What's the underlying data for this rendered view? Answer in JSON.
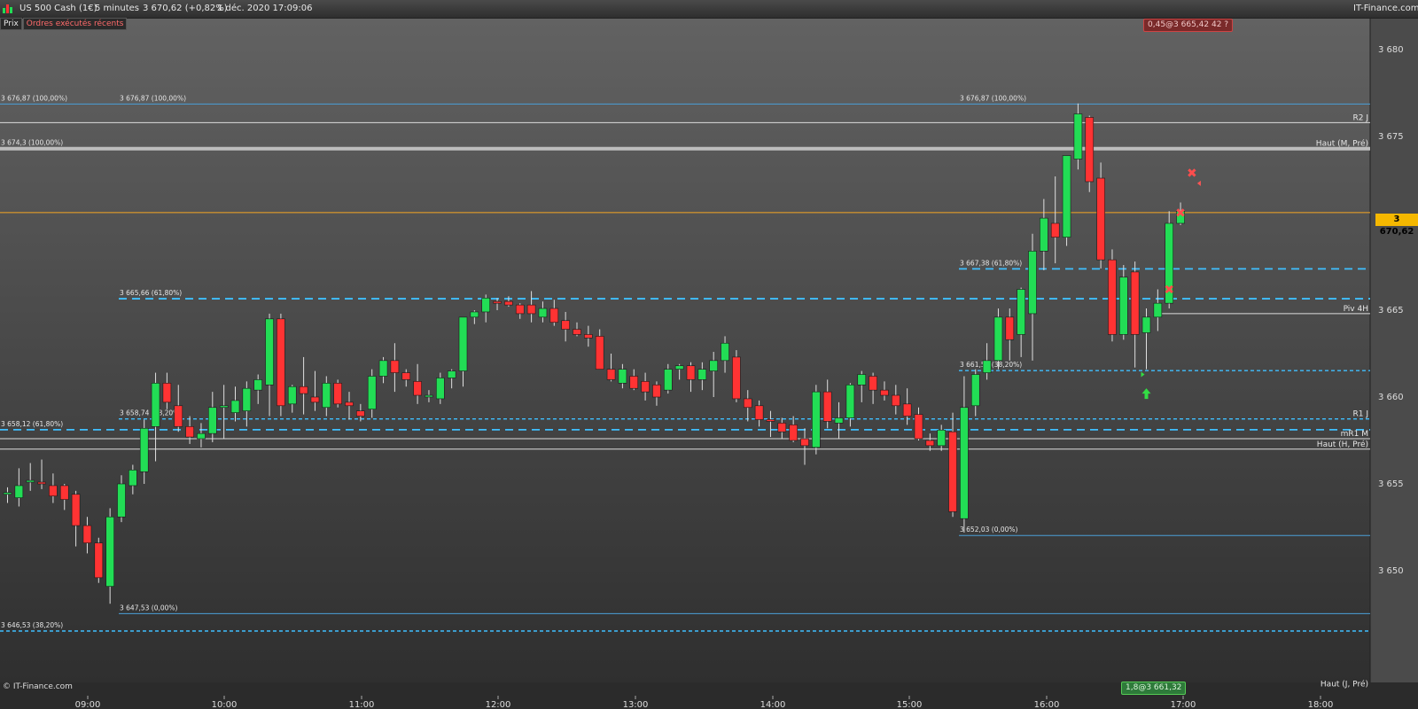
{
  "header": {
    "instrument": "US 500 Cash (1€)",
    "timeframe": "5 minutes",
    "quote": "3 670,62 (+0,82%)",
    "datetime": "1 déc. 2020 17:09:06",
    "brand": "IT-Finance.com"
  },
  "subheader": {
    "prix_label": "Prix",
    "recent_orders_label": "Ordres exécutés récents"
  },
  "badges": {
    "top_order": "0,45@3 665,42 42 ?",
    "bottom_order": "1,8@3 661,32"
  },
  "last_price": "3 670,62",
  "watermark": "© IT-Finance.com",
  "colors": {
    "up": "#22dd55",
    "down": "#ff3333",
    "level_line": "#4a9fd8",
    "dashed_level": "#3fc0ff",
    "last_price": "#f5a623",
    "white_line": "#dddddd"
  },
  "chart_data": {
    "type": "candlestick",
    "ylim": [
      3645,
      3682
    ],
    "yticks": [
      {
        "value": 3680,
        "label": "3 680"
      },
      {
        "value": 3675,
        "label": "3 675"
      },
      {
        "value": 3670,
        "label": "3 670"
      },
      {
        "value": 3665,
        "label": "3 665"
      },
      {
        "value": 3660,
        "label": "3 660"
      },
      {
        "value": 3655,
        "label": "3 655"
      },
      {
        "value": 3650,
        "label": "3 650"
      }
    ],
    "xticks": [
      "09:00",
      "10:00",
      "11:00",
      "12:00",
      "13:00",
      "14:00",
      "15:00",
      "16:00",
      "17:00",
      "18:00"
    ],
    "candles": [
      {
        "o": 3654.4,
        "h": 3654.8,
        "l": 3653.9,
        "c": 3654.5
      },
      {
        "o": 3654.2,
        "h": 3655.9,
        "l": 3653.7,
        "c": 3654.9
      },
      {
        "o": 3655.1,
        "h": 3656.2,
        "l": 3654.6,
        "c": 3655.2
      },
      {
        "o": 3655.1,
        "h": 3656.4,
        "l": 3654.7,
        "c": 3655.0
      },
      {
        "o": 3654.9,
        "h": 3655.6,
        "l": 3653.9,
        "c": 3654.3
      },
      {
        "o": 3654.9,
        "h": 3655.0,
        "l": 3653.5,
        "c": 3654.1
      },
      {
        "o": 3654.4,
        "h": 3654.6,
        "l": 3651.4,
        "c": 3652.6
      },
      {
        "o": 3652.6,
        "h": 3653.1,
        "l": 3651.0,
        "c": 3651.6
      },
      {
        "o": 3651.6,
        "h": 3651.9,
        "l": 3649.3,
        "c": 3649.6
      },
      {
        "o": 3649.1,
        "h": 3653.6,
        "l": 3648.1,
        "c": 3653.1
      },
      {
        "o": 3653.1,
        "h": 3655.5,
        "l": 3652.8,
        "c": 3655.0
      },
      {
        "o": 3654.9,
        "h": 3656.1,
        "l": 3654.4,
        "c": 3655.8
      },
      {
        "o": 3655.7,
        "h": 3658.7,
        "l": 3655.0,
        "c": 3658.2
      },
      {
        "o": 3658.3,
        "h": 3661.4,
        "l": 3656.3,
        "c": 3660.8
      },
      {
        "o": 3660.8,
        "h": 3661.4,
        "l": 3659.3,
        "c": 3659.7
      },
      {
        "o": 3659.5,
        "h": 3660.7,
        "l": 3658.0,
        "c": 3658.3
      },
      {
        "o": 3658.3,
        "h": 3658.9,
        "l": 3657.3,
        "c": 3657.7
      },
      {
        "o": 3657.6,
        "h": 3658.5,
        "l": 3657.1,
        "c": 3657.9
      },
      {
        "o": 3657.9,
        "h": 3660.3,
        "l": 3657.4,
        "c": 3659.4
      },
      {
        "o": 3659.4,
        "h": 3660.7,
        "l": 3657.6,
        "c": 3659.5
      },
      {
        "o": 3659.1,
        "h": 3660.6,
        "l": 3658.6,
        "c": 3659.8
      },
      {
        "o": 3659.2,
        "h": 3660.9,
        "l": 3658.3,
        "c": 3660.5
      },
      {
        "o": 3660.4,
        "h": 3661.3,
        "l": 3659.6,
        "c": 3661.0
      },
      {
        "o": 3660.7,
        "h": 3664.8,
        "l": 3658.9,
        "c": 3664.5
      },
      {
        "o": 3664.5,
        "h": 3664.8,
        "l": 3658.9,
        "c": 3659.5
      },
      {
        "o": 3659.6,
        "h": 3660.7,
        "l": 3659.1,
        "c": 3660.6
      },
      {
        "o": 3660.6,
        "h": 3662.3,
        "l": 3659.0,
        "c": 3660.2
      },
      {
        "o": 3660.0,
        "h": 3661.5,
        "l": 3659.2,
        "c": 3659.7
      },
      {
        "o": 3659.4,
        "h": 3661.2,
        "l": 3658.9,
        "c": 3660.8
      },
      {
        "o": 3660.8,
        "h": 3661.0,
        "l": 3659.4,
        "c": 3659.6
      },
      {
        "o": 3659.7,
        "h": 3660.3,
        "l": 3658.7,
        "c": 3659.5
      },
      {
        "o": 3659.2,
        "h": 3659.6,
        "l": 3658.6,
        "c": 3658.9
      },
      {
        "o": 3659.3,
        "h": 3661.6,
        "l": 3658.8,
        "c": 3661.2
      },
      {
        "o": 3661.2,
        "h": 3662.3,
        "l": 3660.8,
        "c": 3662.1
      },
      {
        "o": 3662.1,
        "h": 3663.1,
        "l": 3660.3,
        "c": 3661.4
      },
      {
        "o": 3661.4,
        "h": 3661.6,
        "l": 3660.6,
        "c": 3661.0
      },
      {
        "o": 3660.9,
        "h": 3661.9,
        "l": 3659.6,
        "c": 3660.1
      },
      {
        "o": 3660.0,
        "h": 3660.4,
        "l": 3659.7,
        "c": 3660.1
      },
      {
        "o": 3659.9,
        "h": 3661.4,
        "l": 3659.6,
        "c": 3661.1
      },
      {
        "o": 3661.1,
        "h": 3661.6,
        "l": 3660.5,
        "c": 3661.5
      },
      {
        "o": 3661.5,
        "h": 3664.6,
        "l": 3660.6,
        "c": 3664.6
      },
      {
        "o": 3664.6,
        "h": 3665.0,
        "l": 3664.2,
        "c": 3664.9
      },
      {
        "o": 3664.9,
        "h": 3665.9,
        "l": 3664.3,
        "c": 3665.7
      },
      {
        "o": 3665.5,
        "h": 3665.7,
        "l": 3665.0,
        "c": 3665.4
      },
      {
        "o": 3665.5,
        "h": 3665.8,
        "l": 3665.2,
        "c": 3665.3
      },
      {
        "o": 3665.3,
        "h": 3665.4,
        "l": 3664.5,
        "c": 3664.8
      },
      {
        "o": 3665.3,
        "h": 3666.1,
        "l": 3664.3,
        "c": 3664.8
      },
      {
        "o": 3664.6,
        "h": 3665.5,
        "l": 3664.3,
        "c": 3665.1
      },
      {
        "o": 3665.1,
        "h": 3665.6,
        "l": 3664.1,
        "c": 3664.3
      },
      {
        "o": 3664.4,
        "h": 3664.9,
        "l": 3663.2,
        "c": 3663.9
      },
      {
        "o": 3663.9,
        "h": 3664.3,
        "l": 3663.5,
        "c": 3663.6
      },
      {
        "o": 3663.6,
        "h": 3664.1,
        "l": 3662.9,
        "c": 3663.4
      },
      {
        "o": 3663.5,
        "h": 3663.9,
        "l": 3661.7,
        "c": 3661.6
      },
      {
        "o": 3661.6,
        "h": 3662.5,
        "l": 3660.9,
        "c": 3661.0
      },
      {
        "o": 3660.8,
        "h": 3661.9,
        "l": 3660.5,
        "c": 3661.6
      },
      {
        "o": 3661.2,
        "h": 3661.6,
        "l": 3660.4,
        "c": 3660.5
      },
      {
        "o": 3660.9,
        "h": 3661.4,
        "l": 3659.8,
        "c": 3660.3
      },
      {
        "o": 3660.7,
        "h": 3660.9,
        "l": 3659.5,
        "c": 3660.0
      },
      {
        "o": 3660.4,
        "h": 3661.9,
        "l": 3660.2,
        "c": 3661.6
      },
      {
        "o": 3661.6,
        "h": 3661.9,
        "l": 3661.0,
        "c": 3661.8
      },
      {
        "o": 3661.8,
        "h": 3662.0,
        "l": 3660.3,
        "c": 3661.0
      },
      {
        "o": 3661.0,
        "h": 3662.0,
        "l": 3660.4,
        "c": 3661.6
      },
      {
        "o": 3661.5,
        "h": 3662.6,
        "l": 3660.0,
        "c": 3662.1
      },
      {
        "o": 3662.1,
        "h": 3663.5,
        "l": 3661.4,
        "c": 3663.1
      },
      {
        "o": 3662.3,
        "h": 3662.7,
        "l": 3659.7,
        "c": 3659.9
      },
      {
        "o": 3659.9,
        "h": 3660.4,
        "l": 3658.6,
        "c": 3659.4
      },
      {
        "o": 3659.5,
        "h": 3659.8,
        "l": 3658.3,
        "c": 3658.7
      },
      {
        "o": 3658.7,
        "h": 3659.2,
        "l": 3657.7,
        "c": 3658.6
      },
      {
        "o": 3658.5,
        "h": 3658.8,
        "l": 3657.6,
        "c": 3658.0
      },
      {
        "o": 3658.4,
        "h": 3658.9,
        "l": 3657.4,
        "c": 3657.5
      },
      {
        "o": 3657.6,
        "h": 3658.2,
        "l": 3656.1,
        "c": 3657.2
      },
      {
        "o": 3657.1,
        "h": 3660.7,
        "l": 3656.7,
        "c": 3660.3
      },
      {
        "o": 3660.3,
        "h": 3661.0,
        "l": 3658.2,
        "c": 3658.6
      },
      {
        "o": 3658.5,
        "h": 3659.7,
        "l": 3657.6,
        "c": 3658.8
      },
      {
        "o": 3658.8,
        "h": 3660.8,
        "l": 3658.3,
        "c": 3660.7
      },
      {
        "o": 3660.7,
        "h": 3661.5,
        "l": 3659.7,
        "c": 3661.3
      },
      {
        "o": 3661.2,
        "h": 3661.4,
        "l": 3659.6,
        "c": 3660.4
      },
      {
        "o": 3660.4,
        "h": 3660.9,
        "l": 3659.8,
        "c": 3660.1
      },
      {
        "o": 3660.1,
        "h": 3660.7,
        "l": 3659.0,
        "c": 3659.5
      },
      {
        "o": 3659.6,
        "h": 3660.5,
        "l": 3658.4,
        "c": 3658.9
      },
      {
        "o": 3659.0,
        "h": 3659.4,
        "l": 3657.5,
        "c": 3657.6
      },
      {
        "o": 3657.5,
        "h": 3657.9,
        "l": 3656.9,
        "c": 3657.2
      },
      {
        "o": 3657.2,
        "h": 3658.4,
        "l": 3656.9,
        "c": 3658.1
      },
      {
        "o": 3658.0,
        "h": 3659.1,
        "l": 3653.1,
        "c": 3653.4
      },
      {
        "o": 3653.0,
        "h": 3661.2,
        "l": 3652.2,
        "c": 3659.4
      },
      {
        "o": 3659.5,
        "h": 3661.6,
        "l": 3658.9,
        "c": 3661.3
      },
      {
        "o": 3661.4,
        "h": 3663.1,
        "l": 3661.0,
        "c": 3662.1
      },
      {
        "o": 3662.1,
        "h": 3665.1,
        "l": 3661.6,
        "c": 3664.6
      },
      {
        "o": 3664.6,
        "h": 3665.1,
        "l": 3662.1,
        "c": 3663.3
      },
      {
        "o": 3663.6,
        "h": 3666.3,
        "l": 3662.3,
        "c": 3666.2
      },
      {
        "o": 3664.8,
        "h": 3669.4,
        "l": 3662.1,
        "c": 3668.4
      },
      {
        "o": 3668.4,
        "h": 3671.4,
        "l": 3667.3,
        "c": 3670.3
      },
      {
        "o": 3670.0,
        "h": 3672.7,
        "l": 3667.7,
        "c": 3669.2
      },
      {
        "o": 3669.2,
        "h": 3673.6,
        "l": 3668.7,
        "c": 3673.9
      },
      {
        "o": 3673.7,
        "h": 3676.9,
        "l": 3673.1,
        "c": 3676.3
      },
      {
        "o": 3676.1,
        "h": 3676.2,
        "l": 3671.8,
        "c": 3672.4
      },
      {
        "o": 3672.6,
        "h": 3673.5,
        "l": 3667.4,
        "c": 3667.9
      },
      {
        "o": 3667.9,
        "h": 3668.5,
        "l": 3663.2,
        "c": 3663.6
      },
      {
        "o": 3663.6,
        "h": 3667.6,
        "l": 3663.3,
        "c": 3666.9
      },
      {
        "o": 3667.2,
        "h": 3667.8,
        "l": 3661.7,
        "c": 3663.6
      },
      {
        "o": 3663.7,
        "h": 3665.1,
        "l": 3661.6,
        "c": 3664.6
      },
      {
        "o": 3664.6,
        "h": 3666.2,
        "l": 3663.8,
        "c": 3665.4
      },
      {
        "o": 3665.4,
        "h": 3670.7,
        "l": 3665.1,
        "c": 3670.0
      },
      {
        "o": 3670.0,
        "h": 3671.2,
        "l": 3669.9,
        "c": 3670.7
      }
    ],
    "levels": [
      {
        "value": 3676.87,
        "style": "solid",
        "color": "level",
        "from_x": 0,
        "label": "3 676,87 (100,00%)",
        "label_left": "3 676,87 (100,00%)"
      },
      {
        "value": 3676.87,
        "style": "none",
        "from_x": 134,
        "label": "3 676,87 (100,00%)"
      },
      {
        "value": 3676.87,
        "style": "none",
        "from_x": 1082,
        "label": "3 676,87 (100,00%)"
      },
      {
        "value": 3675.8,
        "style": "solid",
        "color": "white",
        "from_x": 0,
        "right_label": "R2 J"
      },
      {
        "value": 3674.3,
        "style": "thick",
        "color": "grey",
        "from_x": 0,
        "label": "3 674,3 (100,00%)",
        "right_label": "Haut (M, Pré)"
      },
      {
        "value": 3670.62,
        "style": "solid",
        "color": "last",
        "from_x": 0
      },
      {
        "value": 3667.38,
        "style": "dashed",
        "color": "dashed",
        "from_x": 1082,
        "label": "3 667,38 (61,80%)"
      },
      {
        "value": 3665.66,
        "style": "dashed",
        "color": "dashed",
        "from_x": 134,
        "label": "3 665,66 (61,80%)"
      },
      {
        "value": 3664.8,
        "style": "solid",
        "color": "white",
        "from_x": 1308,
        "right_label": "Piv 4H"
      },
      {
        "value": 3661.52,
        "style": "dotted",
        "color": "dashed",
        "from_x": 1082,
        "label": "3 661,52 (38,20%)"
      },
      {
        "value": 3658.74,
        "style": "dotted",
        "color": "dashed",
        "from_x": 134,
        "label": "3 658,74 (38,20%)",
        "right_label": "R1 J"
      },
      {
        "value": 3658.12,
        "style": "dashed",
        "color": "dashed",
        "from_x": 0,
        "label": "3 658,12 (61,80%)"
      },
      {
        "value": 3657.6,
        "style": "solid",
        "color": "white",
        "from_x": 0,
        "right_label": "mR1 M"
      },
      {
        "value": 3657.0,
        "style": "solid",
        "color": "white",
        "from_x": 0,
        "right_label": "Haut (H, Pré)"
      },
      {
        "value": 3652.03,
        "style": "solid",
        "color": "level",
        "from_x": 1082,
        "label": "3 652,03 (0,00%)"
      },
      {
        "value": 3647.53,
        "style": "solid",
        "color": "level",
        "from_x": 134,
        "label": "3 647,53 (0,00%)"
      },
      {
        "value": 3646.53,
        "style": "dotted",
        "color": "dashed",
        "from_x": 0,
        "label": "3 646,53 (38,20%)"
      },
      {
        "value": 3643.2,
        "style": "none",
        "from_x": 0,
        "right_label": "Haut (J, Pré)"
      }
    ],
    "markers": [
      {
        "type": "x",
        "candle": 104,
        "value": 3672.9
      },
      {
        "type": "x",
        "candle": 103,
        "value": 3670.6
      },
      {
        "type": "x",
        "candle": 102,
        "value": 3666.2
      },
      {
        "type": "arrow-up",
        "candle": 100,
        "value": 3660.2
      },
      {
        "type": "arrow-right",
        "candle": 100,
        "value": 3661.3
      },
      {
        "type": "arrow-left",
        "candle": 104,
        "value": 3672.3
      }
    ]
  }
}
